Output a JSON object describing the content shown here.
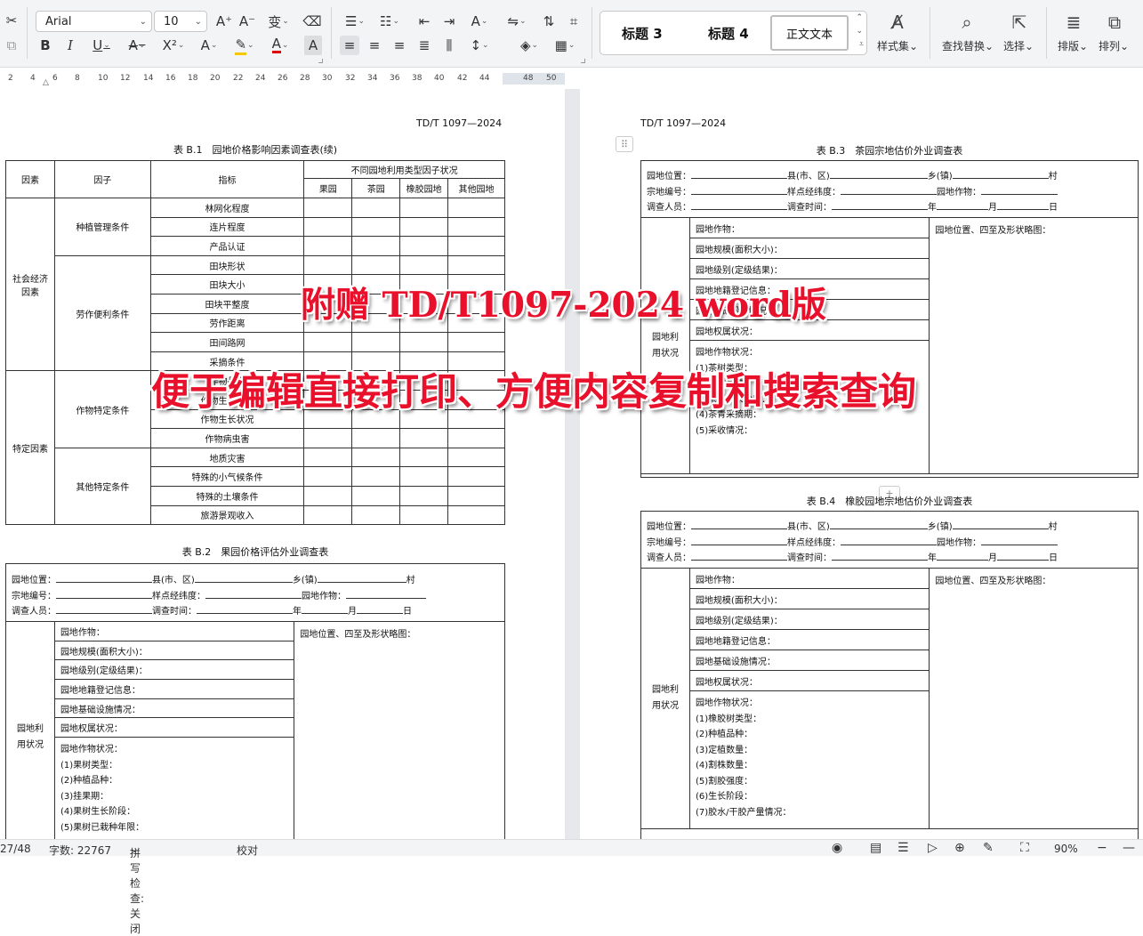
{
  "toolbar": {
    "font_name": "Arial",
    "font_size": "10",
    "styles": {
      "h3": "标题 3",
      "h4": "标题 4",
      "normal": "正文文本"
    },
    "style_set_label": "样式集",
    "find_label": "查找替换",
    "select_label": "选择",
    "layout_label": "排版",
    "arrange_label": "排列"
  },
  "ruler": [
    "2",
    "4",
    "6",
    "8",
    "10",
    "12",
    "14",
    "16",
    "18",
    "20",
    "22",
    "24",
    "26",
    "28",
    "30",
    "32",
    "34",
    "36",
    "38",
    "40",
    "42",
    "44",
    "48",
    "50"
  ],
  "left_page": {
    "header": "TD/T 1097—2024",
    "t1": {
      "title": "表 B.1　园地价格影响因素调查表(续)",
      "h_factor": "因素",
      "h_sub": "因子",
      "h_index": "指标",
      "h_group": "不同园地利用类型因子状况",
      "h_types": [
        "果园",
        "茶园",
        "橡胶园地",
        "其他园地"
      ],
      "factor1": "社会经济因素",
      "factor2": "特定因素",
      "sub1": "种植管理条件",
      "sub2": "劳作便利条件",
      "sub3": "作物特定条件",
      "sub4": "其他特定条件",
      "indicators": [
        "林网化程度",
        "连片程度",
        "产品认证",
        "田块形状",
        "田块大小",
        "田块平整度",
        "劳作距离",
        "田间路网",
        "采摘条件",
        "作物品质",
        "作物生长阶段",
        "作物生长状况",
        "作物病虫害",
        "地质灾害",
        "特殊的小气候条件",
        "特殊的土壤条件",
        "旅游景观收入"
      ]
    },
    "t2": {
      "title": "表 B.2　果园价格评估外业调查表",
      "loc": "园地位置：",
      "county": "县(市、区)",
      "town": "乡(镇)",
      "village": "村",
      "code": "宗地编号：",
      "coord": "样点经纬度：",
      "crop_lbl": "园地作物：",
      "surveyor": "调查人员：",
      "time": "调查时间：",
      "year": "年",
      "month": "月",
      "day": "日",
      "side": "园地利用状况",
      "rows": [
        "园地作物：",
        "园地规模(面积大小)：",
        "园地级别(定级结果)：",
        "园地地籍登记信息：",
        "园地基础设施情况：",
        "园地权属状况："
      ],
      "sketch": "园地位置、四至及形状略图：",
      "status_lines": [
        "园地作物状况：",
        "(1)果树类型：",
        "(2)种植品种：",
        "(3)挂果期：",
        "(4)果树生长阶段：",
        "(5)果树已栽种年限："
      ]
    }
  },
  "right_page": {
    "header": "TD/T 1097—2024",
    "t3": {
      "title": "表 B.3　茶园宗地估价外业调查表",
      "side": "园地利用状况",
      "rows": [
        "园地作物：",
        "园地规模(面积大小)：",
        "园地级别(定级结果)：",
        "园地地籍登记信息：",
        "园地基础设施情况：",
        "园地权属状况："
      ],
      "sketch": "园地位置、四至及形状略图：",
      "status_lines": [
        "园地作物状况：",
        "(1)茶树类型：",
        "(2)茶树品种：",
        "(3)茶树生长阶段：",
        "(4)茶青采摘期：",
        "(5)采收情况："
      ]
    },
    "t4": {
      "title": "表 B.4　橡胶园地宗地估价外业调查表",
      "side": "园地利用状况",
      "rows": [
        "园地作物：",
        "园地规模(面积大小)：",
        "园地级别(定级结果)：",
        "园地地籍登记信息：",
        "园地基础设施情况：",
        "园地权属状况："
      ],
      "sketch": "园地位置、四至及形状略图：",
      "status_lines": [
        "园地作物状况：",
        "(1)橡胶树类型：",
        "(2)种植品种：",
        "(3)定植数量：",
        "(4)割株数量：",
        "(5)割胶强度：",
        "(6)生长阶段：",
        "(7)胶水/干胶产量情况："
      ]
    }
  },
  "overlay": {
    "line1": "附赠 TD/T1097-2024 word版",
    "line2": "便于编辑直接打印、方便内容复制和搜索查询"
  },
  "status": {
    "page": "27/48",
    "words": "字数: 22767",
    "spell": "拼写检查: 关闭",
    "proof": "校对",
    "zoom": "90%"
  }
}
